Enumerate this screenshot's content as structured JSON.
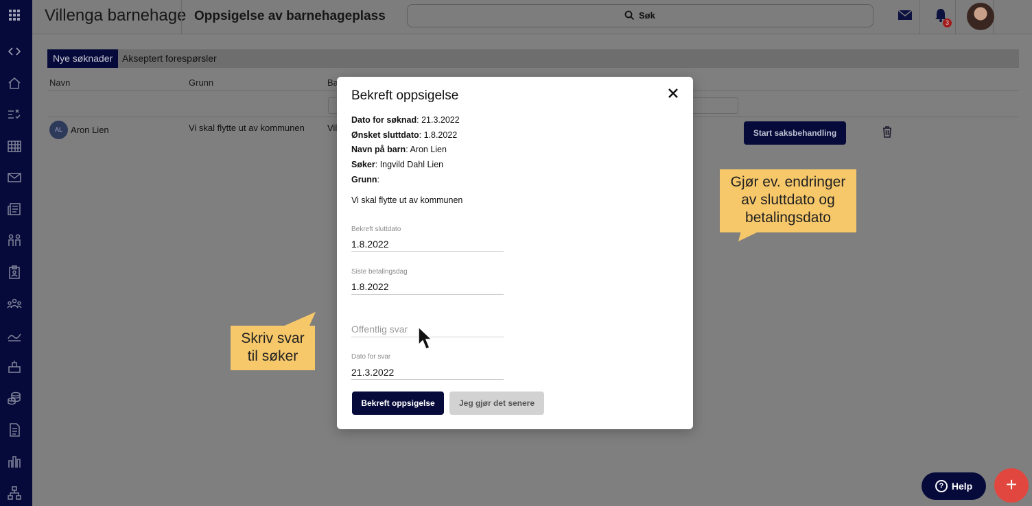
{
  "app": {
    "title": "Villenga barnehage",
    "page_title": "Oppsigelse av barnehageplass"
  },
  "search": {
    "label": "Søk"
  },
  "notifications": {
    "count": "3"
  },
  "sidebar": {
    "icons": [
      "apps-icon",
      "code-icon",
      "home-icon",
      "tasks-icon",
      "calendar-icon",
      "mail-icon",
      "news-icon",
      "children-icon",
      "clipboard-icon",
      "groups-icon",
      "stats-icon",
      "kindergarten-icon",
      "coins-icon",
      "document-icon",
      "chart-icon",
      "org-icon"
    ]
  },
  "tabs": [
    {
      "label": "Nye søknader",
      "active": true
    },
    {
      "label": "Akseptert forespørsler",
      "active": false
    }
  ],
  "table": {
    "headers": [
      "Navn",
      "Grunn",
      "Ba"
    ],
    "row": {
      "initials": "AL",
      "name": "Aron Lien",
      "reason": "Vi skal flytte ut av kommunen",
      "col3": "Vil",
      "action": "Start saksbehandling"
    }
  },
  "modal": {
    "title": "Bekreft oppsigelse",
    "info": [
      {
        "label": "Dato for søknad",
        "value": ": 21.3.2022"
      },
      {
        "label": "Ønsket sluttdato",
        "value": ": 1.8.2022"
      },
      {
        "label": "Navn på barn",
        "value": ": Aron Lien"
      },
      {
        "label": "Søker",
        "value": ": Ingvild Dahl Lien"
      },
      {
        "label": "Grunn",
        "value": ":"
      }
    ],
    "reason_text": "Vi skal flytte ut av kommunen",
    "fields": {
      "end_date": {
        "label": "Bekreft sluttdato",
        "value": "1.8.2022"
      },
      "last_payment": {
        "label": "Siste betalingsdag",
        "value": "1.8.2022"
      },
      "public_reply": {
        "placeholder": "Offentlig svar"
      },
      "reply_date": {
        "label": "Dato for svar",
        "value": "21.3.2022"
      }
    },
    "confirm_button": "Bekreft oppsigelse",
    "later_button": "Jeg gjør det senere"
  },
  "callouts": {
    "right": [
      "Gjør ev. endringer",
      "av sluttdato og",
      "betalingsdato"
    ],
    "left": [
      "Skriv svar",
      "til søker"
    ]
  },
  "help": {
    "label": "Help"
  },
  "fab": {
    "label": "+"
  },
  "colors": {
    "brand_navy": "#050a3a",
    "callout": "#f7c86a",
    "fab": "#e1473f"
  }
}
